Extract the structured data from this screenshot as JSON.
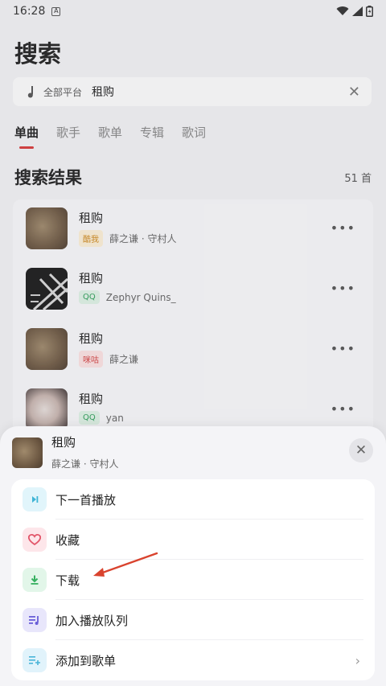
{
  "status_bar": {
    "time": "16:28",
    "notification_icon": "A"
  },
  "page": {
    "title": "搜索"
  },
  "search": {
    "platform": "全部平台",
    "query": "租购",
    "clear_icon": "close-icon"
  },
  "tabs": [
    {
      "label": "单曲",
      "active": true
    },
    {
      "label": "歌手",
      "active": false
    },
    {
      "label": "歌单",
      "active": false
    },
    {
      "label": "专辑",
      "active": false
    },
    {
      "label": "歌词",
      "active": false
    }
  ],
  "results": {
    "title": "搜索结果",
    "count": "51 首",
    "songs": [
      {
        "title": "租购",
        "source": "酷我",
        "artist": "薛之谦 · 守村人"
      },
      {
        "title": "租购",
        "source": "QQ",
        "artist": "Zephyr Quins_"
      },
      {
        "title": "租购",
        "source": "咪咕",
        "artist": "薛之谦"
      },
      {
        "title": "租购",
        "source": "QQ",
        "artist": "yan"
      }
    ]
  },
  "sheet": {
    "title": "租购",
    "subtitle": "薛之谦 · 守村人",
    "menu": [
      {
        "label": "下一首播放",
        "icon": "play-next-icon"
      },
      {
        "label": "收藏",
        "icon": "heart-icon"
      },
      {
        "label": "下载",
        "icon": "download-icon"
      },
      {
        "label": "加入播放队列",
        "icon": "queue-icon"
      },
      {
        "label": "添加到歌单",
        "icon": "playlist-add-icon"
      }
    ]
  },
  "colors": {
    "accent": "#d93a3a",
    "annotation_arrow": "#d9432e"
  }
}
